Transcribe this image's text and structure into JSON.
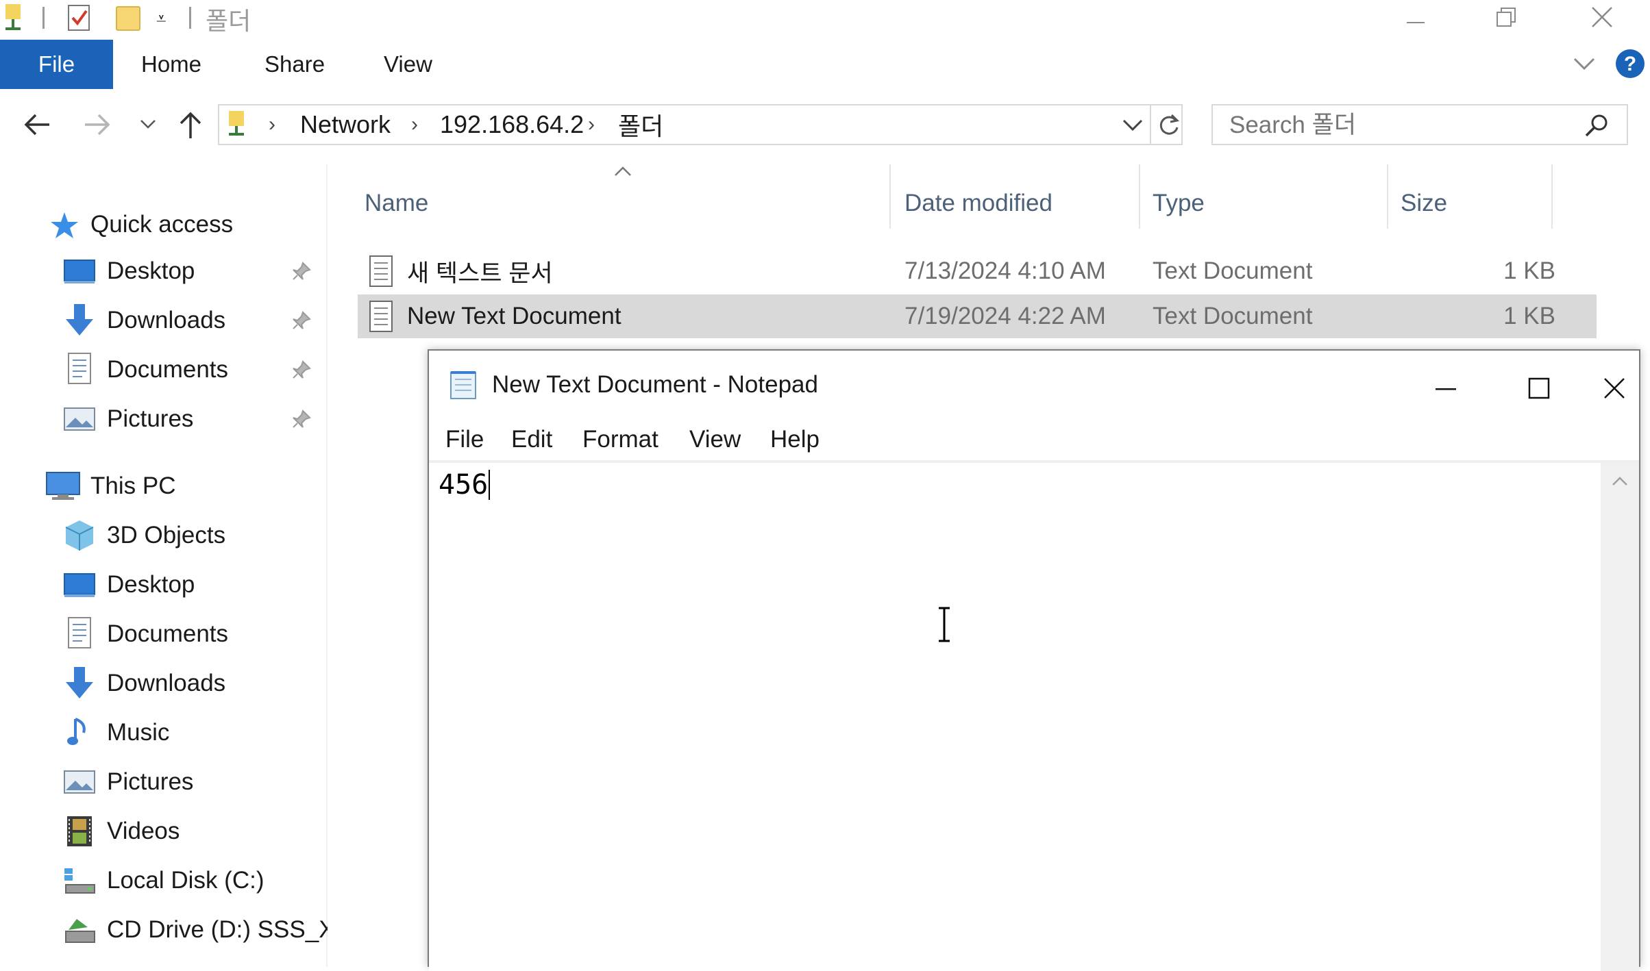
{
  "explorer": {
    "title": "폴더",
    "ribbon_tabs": [
      "File",
      "Home",
      "Share",
      "View"
    ],
    "address": {
      "crumbs": [
        "Network",
        "192.168.64.2",
        "폴더"
      ]
    },
    "search": {
      "placeholder": "Search 폴더"
    },
    "sidebar": {
      "quick_access": {
        "label": "Quick access",
        "items": [
          {
            "label": "Desktop",
            "icon": "desktop-icon"
          },
          {
            "label": "Downloads",
            "icon": "downloads-icon"
          },
          {
            "label": "Documents",
            "icon": "documents-icon"
          },
          {
            "label": "Pictures",
            "icon": "pictures-icon"
          }
        ]
      },
      "this_pc": {
        "label": "This PC",
        "items": [
          {
            "label": "3D Objects",
            "icon": "3d-objects-icon"
          },
          {
            "label": "Desktop",
            "icon": "desktop-icon"
          },
          {
            "label": "Documents",
            "icon": "documents-icon"
          },
          {
            "label": "Downloads",
            "icon": "downloads-icon"
          },
          {
            "label": "Music",
            "icon": "music-icon"
          },
          {
            "label": "Pictures",
            "icon": "pictures-icon"
          },
          {
            "label": "Videos",
            "icon": "videos-icon"
          },
          {
            "label": "Local Disk (C:)",
            "icon": "local-disk-icon"
          },
          {
            "label": "CD Drive (D:) SSS_X(",
            "icon": "cd-drive-icon"
          }
        ]
      }
    },
    "columns": [
      "Name",
      "Date modified",
      "Type",
      "Size"
    ],
    "files": [
      {
        "name": "새 텍스트 문서",
        "date": "7/13/2024 4:10 AM",
        "type": "Text Document",
        "size": "1 KB",
        "selected": false
      },
      {
        "name": "New Text Document",
        "date": "7/19/2024 4:22 AM",
        "type": "Text Document",
        "size": "1 KB",
        "selected": true
      }
    ],
    "colors": {
      "accent": "#1a63b8",
      "selection": "#d9d9d9"
    }
  },
  "notepad": {
    "title": "New Text Document - Notepad",
    "menu": [
      "File",
      "Edit",
      "Format",
      "View",
      "Help"
    ],
    "content": "456"
  }
}
